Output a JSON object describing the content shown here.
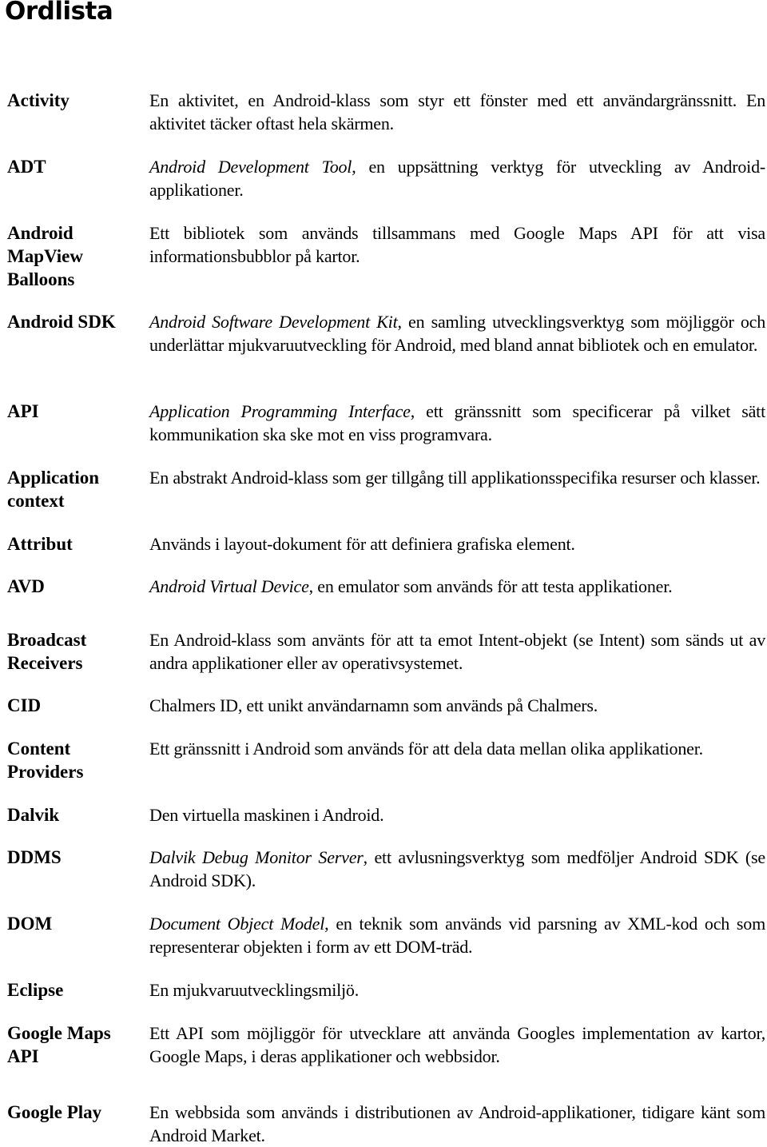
{
  "page": {
    "title": "Ordlista"
  },
  "glossary": [
    {
      "term": "Activity",
      "italic": "",
      "text": "En aktivitet, en Android-klass som styr ett fönster med ett användargränssnitt. En aktivitet täcker oftast hela skärmen."
    },
    {
      "term": "ADT",
      "italic": "Android Development Tool",
      "text": ", en uppsättning verktyg för utveckling av Android-applikationer."
    },
    {
      "term": "Android MapView Balloons",
      "italic": "",
      "text": "Ett bibliotek som används tillsammans med Google Maps API för att visa informationsbubblor på kartor."
    },
    {
      "term": "Android SDK",
      "italic": "Android Software Development Kit",
      "text": ", en samling utvecklingsverktyg som möjliggör och underlättar mjukvaruutveckling för Android, med bland annat bibliotek och en emulator."
    },
    {
      "term": "API",
      "italic": "Application Programming Interface",
      "text": ", ett gränssnitt som specificerar på vilket sätt kommunikation ska ske mot en viss programvara."
    },
    {
      "term": "Application context",
      "italic": "",
      "text": "En abstrakt Android-klass som ger tillgång till applikationsspecifika resurser och klasser."
    },
    {
      "term": "Attribut",
      "italic": "",
      "text": "Används i layout-dokument för att definiera grafiska element."
    },
    {
      "term": "AVD",
      "italic": "Android Virtual Device",
      "text": ", en emulator som används för att testa applikationer."
    },
    {
      "term": "Broadcast Receivers",
      "italic": "",
      "text": "En Android-klass som använts för att ta emot Intent-objekt (se Intent) som sänds ut av andra applikationer eller av operativsystemet."
    },
    {
      "term": "CID",
      "italic": "",
      "text": "Chalmers ID, ett unikt användarnamn som används på Chalmers."
    },
    {
      "term": "Content Providers",
      "italic": "",
      "text": "Ett gränssnitt i Android som används för att dela data mellan olika applikationer."
    },
    {
      "term": "Dalvik",
      "italic": "",
      "text": "Den virtuella maskinen i Android."
    },
    {
      "term": "DDMS",
      "italic": "Dalvik Debug Monitor Server",
      "text": ", ett avlusningsverktyg som medföljer Android SDK (se Android SDK)."
    },
    {
      "term": "DOM",
      "italic": "Document Object Model",
      "text": ", en teknik som används vid parsning av XML-kod och som representerar objekten i form av ett DOM-träd."
    },
    {
      "term": "Eclipse",
      "italic": "",
      "text": "En mjukvaruutvecklingsmiljö."
    },
    {
      "term": "Google Maps API",
      "italic": "",
      "text": "Ett API som möjliggör för utvecklare att använda Googles implementation av kartor, Google Maps, i deras applikationer och webbsidor."
    },
    {
      "term": "Google Play",
      "italic": "",
      "text": "En webbsida som används i distributionen av Android-applikationer, tidigare känt som Android Market."
    }
  ]
}
